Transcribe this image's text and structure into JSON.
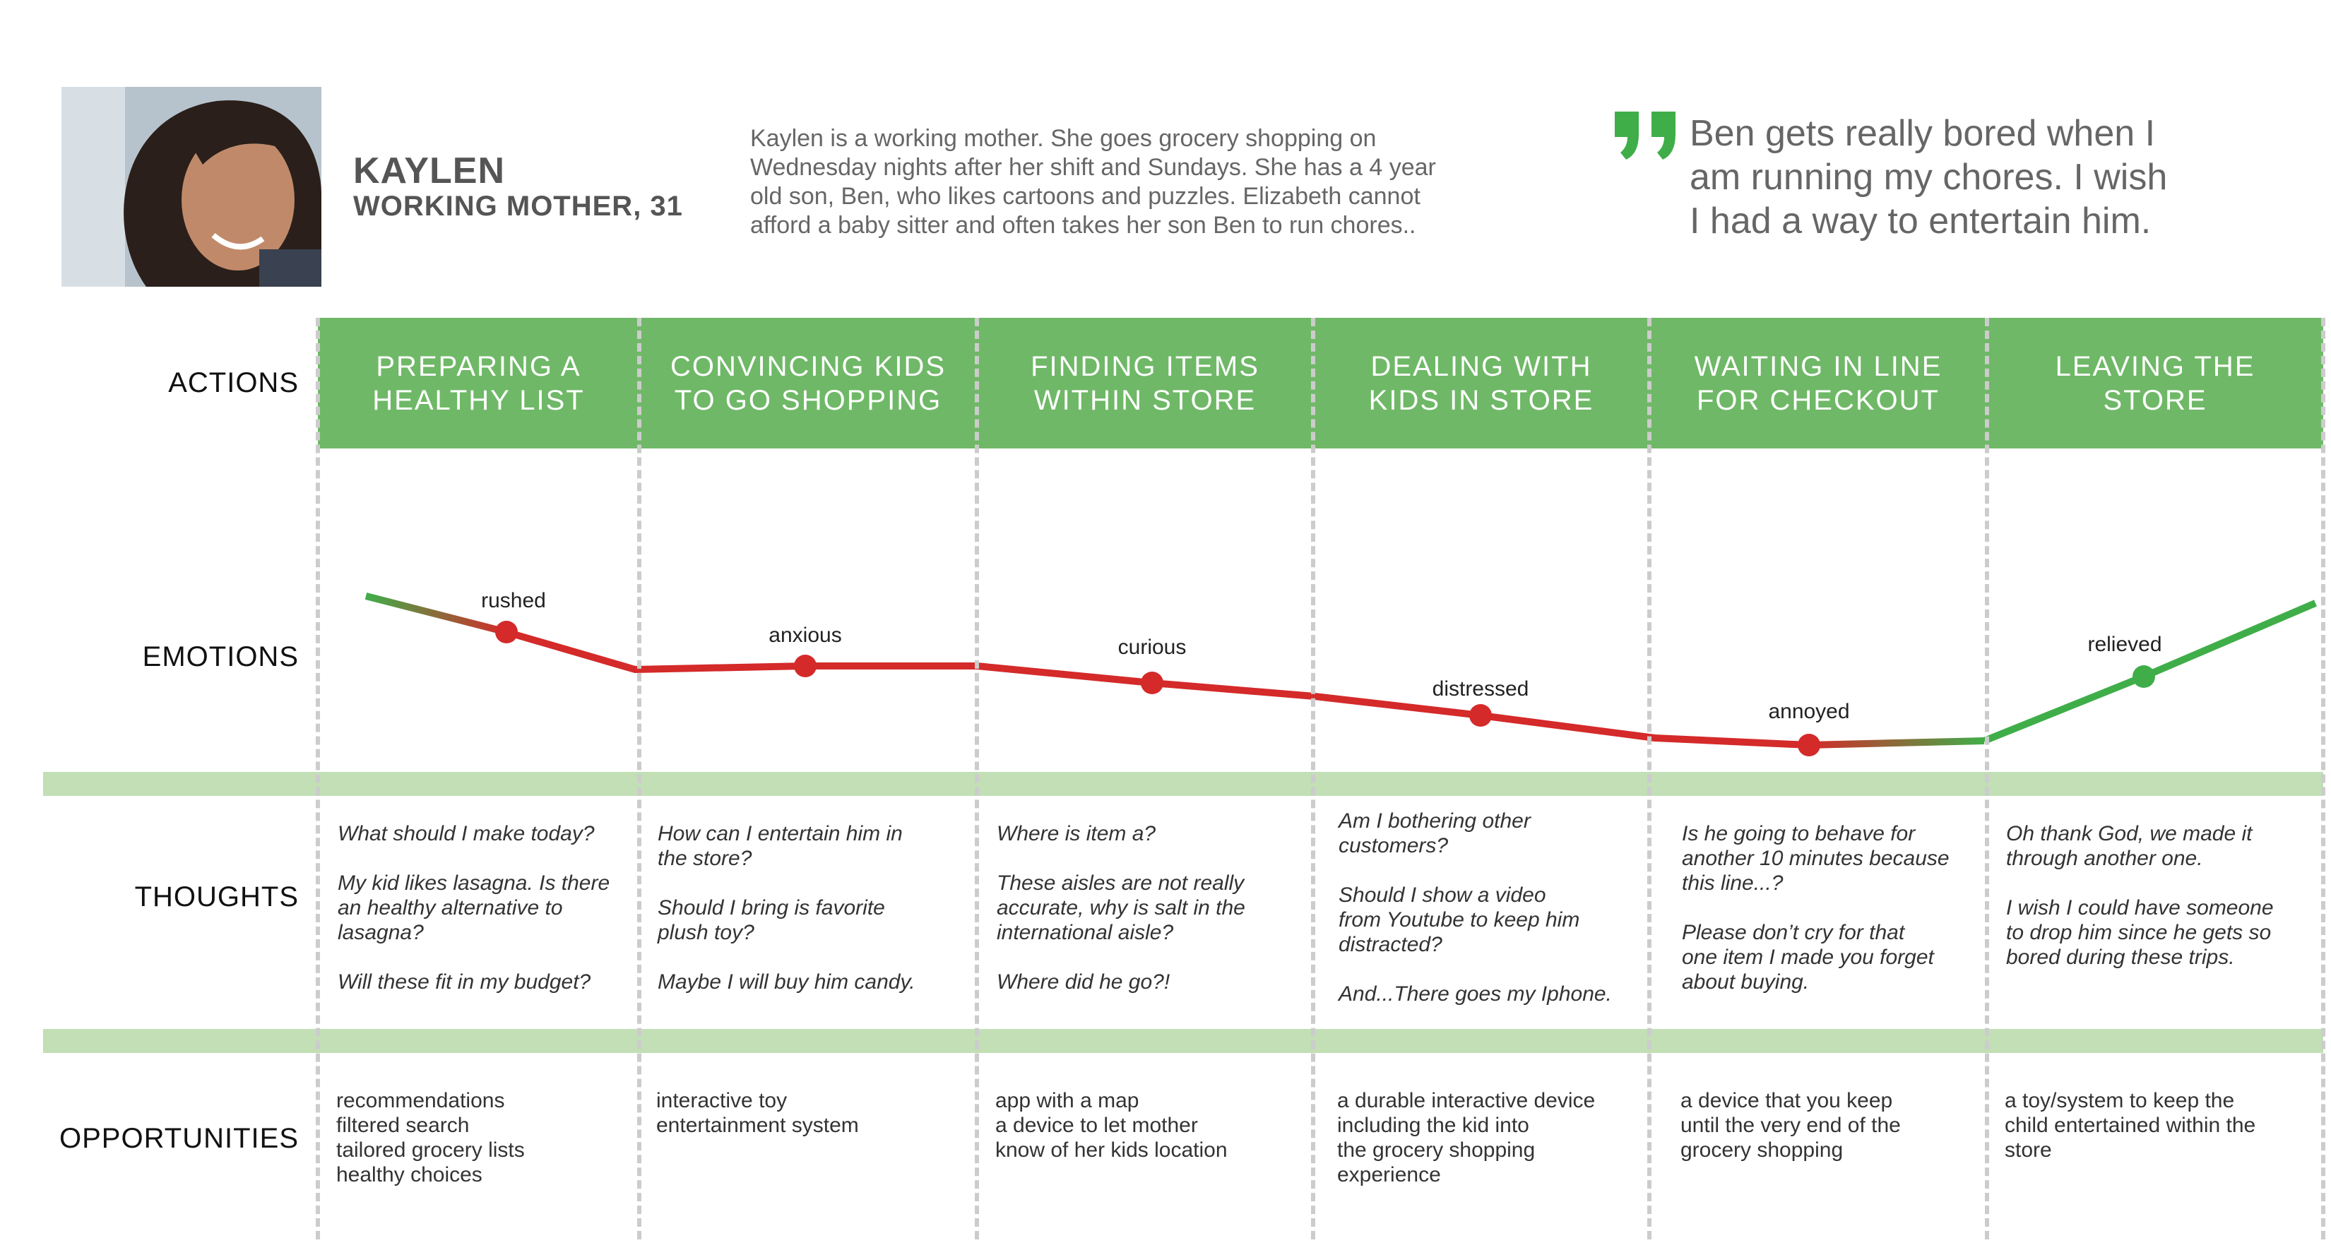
{
  "persona": {
    "name": "KAYLEN",
    "role": "WORKING MOTHER, 31",
    "description_lines": [
      "Kaylen is a working mother. She goes grocery shopping on",
      "Wednesday nights after her shift and Sundays. She has a 4 year",
      "old son, Ben, who likes cartoons and puzzles. Elizabeth cannot",
      "afford a baby sitter and often takes her son Ben to run chores.."
    ],
    "quote_lines": [
      "Ben gets really bored when I",
      "am running my chores. I wish",
      "I had a way to entertain him."
    ]
  },
  "row_labels": {
    "actions": "ACTIONS",
    "emotions": "EMOTIONS",
    "thoughts": "THOUGHTS",
    "opportunities": "OPPORTUNITIES"
  },
  "colors": {
    "action_green": "#6fb867",
    "band_green": "#c2dfb5",
    "negative": "#d42a2a",
    "positive": "#3fae49",
    "quote_mark": "#3fae49"
  },
  "stages": [
    {
      "action": [
        "PREPARING A",
        "HEALTHY LIST"
      ],
      "emotion": "rushed",
      "valence": "negative",
      "thoughts": [
        [
          "What should I make today?"
        ],
        [
          "My kid likes lasagna. Is there",
          "an healthy alternative to",
          "lasagna?"
        ],
        [
          "Will these fit in my budget?"
        ]
      ],
      "opportunities": [
        "recommendations",
        "filtered search",
        "tailored grocery lists",
        "healthy choices"
      ]
    },
    {
      "action": [
        "CONVINCING KIDS",
        "TO GO SHOPPING"
      ],
      "emotion": "anxious",
      "valence": "negative",
      "thoughts": [
        [
          "How can I entertain him in",
          "the store?"
        ],
        [
          "Should I bring is favorite",
          "plush toy?"
        ],
        [
          "Maybe I will buy him candy."
        ]
      ],
      "opportunities": [
        "interactive toy",
        "entertainment system"
      ]
    },
    {
      "action": [
        "FINDING ITEMS",
        "WITHIN STORE"
      ],
      "emotion": "curious",
      "valence": "negative",
      "thoughts": [
        [
          "Where is item a?"
        ],
        [
          "These aisles are not really",
          "accurate, why is salt in the",
          "international aisle?"
        ],
        [
          "Where did he go?!"
        ]
      ],
      "opportunities": [
        "app with a map",
        "a device to let mother",
        "know of her kids location"
      ]
    },
    {
      "action": [
        "DEALING WITH",
        "KIDS IN STORE"
      ],
      "emotion": "distressed",
      "valence": "negative",
      "thoughts": [
        [
          "Am I bothering other",
          "customers?"
        ],
        [
          "Should I show a video",
          "from Youtube to keep him",
          "distracted?"
        ],
        [
          "And...There goes my Iphone."
        ]
      ],
      "opportunities": [
        "a durable interactive device",
        "including the kid into",
        "the  grocery shopping",
        "experience"
      ]
    },
    {
      "action": [
        "WAITING IN LINE",
        "FOR CHECKOUT"
      ],
      "emotion": "annoyed",
      "valence": "negative",
      "thoughts": [
        [
          "Is he going to behave for",
          "another 10 minutes because",
          "this line...?"
        ],
        [
          "Please don’t cry for that",
          "one item I made you forget",
          "about buying."
        ]
      ],
      "opportunities": [
        "a device  that you keep",
        "until the very end of the",
        "grocery shopping"
      ]
    },
    {
      "action": [
        "LEAVING THE",
        "STORE"
      ],
      "emotion": "relieved",
      "valence": "positive",
      "thoughts": [
        [
          "Oh thank God, we made it",
          "through another one."
        ],
        [
          "I wish I could have someone",
          "to drop him since he gets so",
          "bored during these trips."
        ]
      ],
      "opportunities": [
        "a toy/system to keep the",
        "child entertained within the",
        "store"
      ]
    }
  ]
}
